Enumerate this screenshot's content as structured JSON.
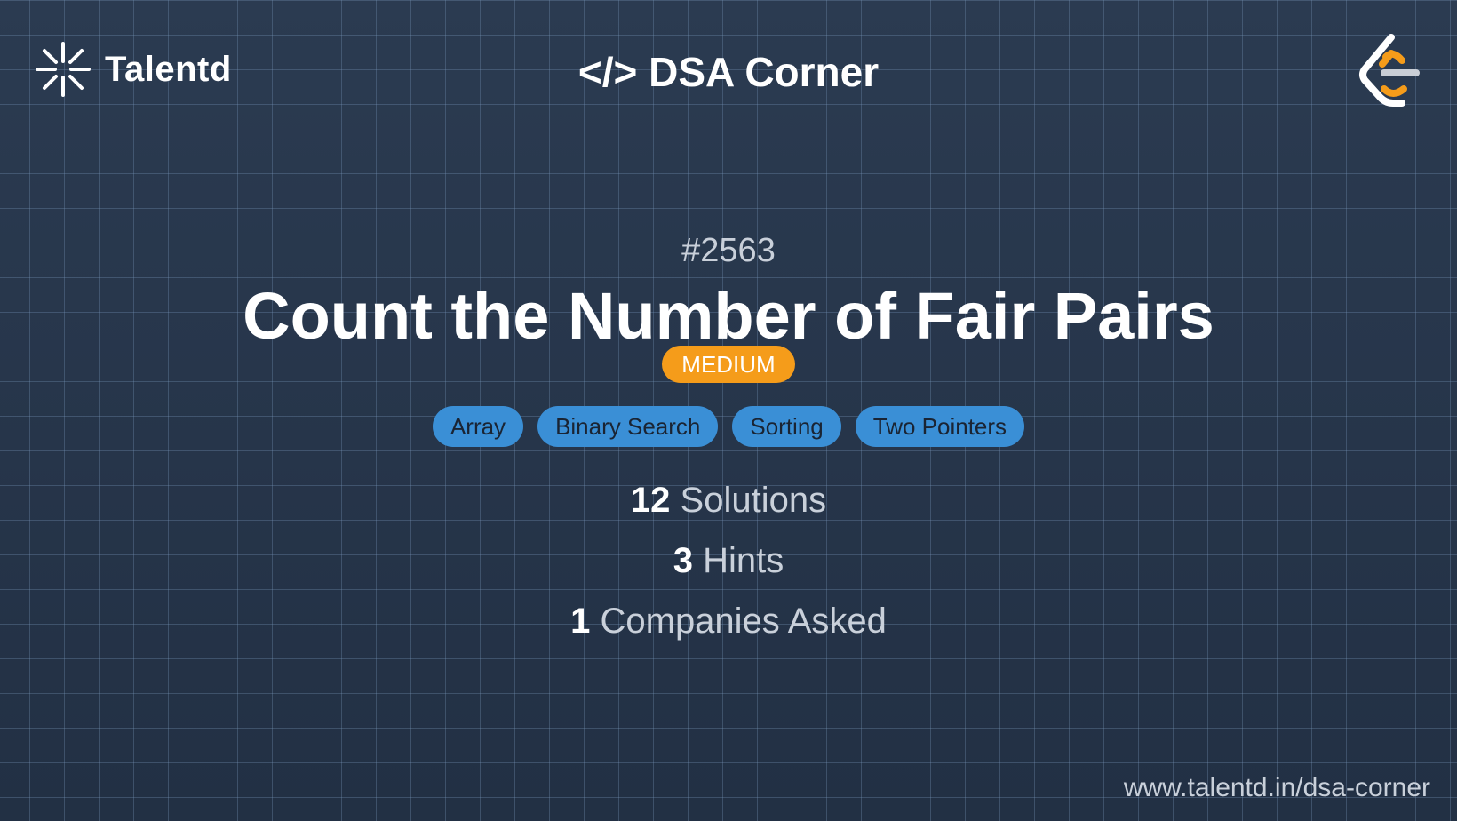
{
  "brand": {
    "name": "Talentd",
    "logo_icon": "spark-icon"
  },
  "header": {
    "title": "</> DSA Corner",
    "right_icon": "leetcode-logo-icon"
  },
  "problem": {
    "number": "#2563",
    "title": "Count the Number of Fair Pairs",
    "difficulty": "MEDIUM",
    "tags": [
      "Array",
      "Binary Search",
      "Sorting",
      "Two Pointers"
    ]
  },
  "stats": [
    {
      "count": "12",
      "label": "Solutions"
    },
    {
      "count": "3",
      "label": "Hints"
    },
    {
      "count": "1",
      "label": "Companies Asked"
    }
  ],
  "footer": {
    "url": "www.talentd.in/dsa-corner"
  },
  "colors": {
    "background": "#263447",
    "difficulty_medium": "#f59c1a",
    "tag_background": "#3a8fd6",
    "leetcode_orange": "#f59c1a"
  }
}
